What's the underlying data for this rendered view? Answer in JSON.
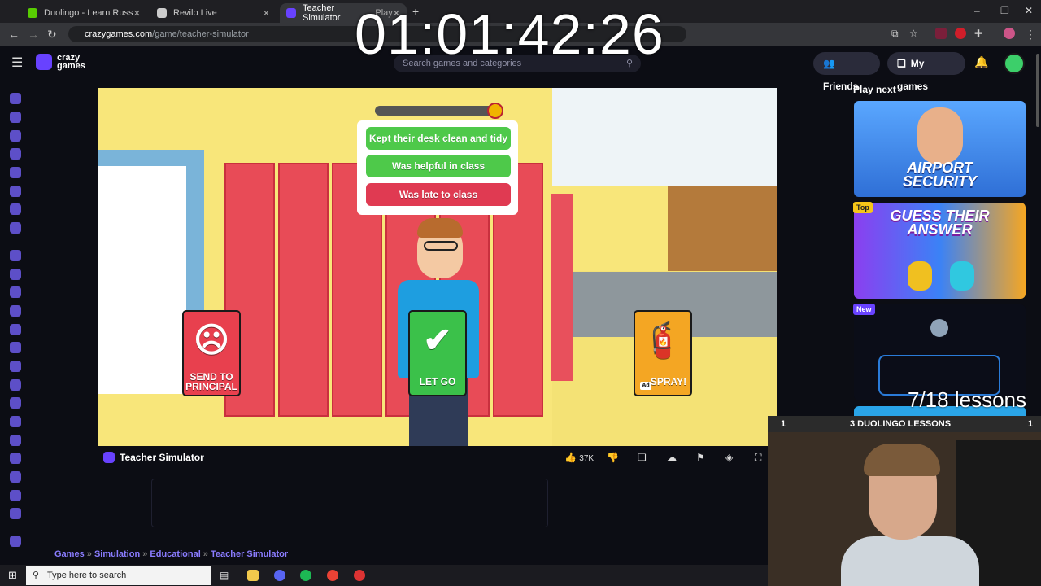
{
  "browser": {
    "tabs": [
      {
        "title": "Duolingo - Learn Russian with l",
        "active": false
      },
      {
        "title": "Revilo Live",
        "active": false
      },
      {
        "title": "Teacher Simulator",
        "active": true
      }
    ],
    "active_tab_suffix": "Play",
    "url_host": "crazygames.com",
    "url_path": "/game/teacher-simulator"
  },
  "site": {
    "logo_line1": "crazy",
    "logo_line2": "games",
    "search_placeholder": "Search games and categories",
    "friends_label": "Friends",
    "mygames_label": "My games"
  },
  "game": {
    "choices": [
      {
        "label": "Kept their desk clean and tidy",
        "color": "#4ec94a"
      },
      {
        "label": "Was helpful in class",
        "color": "#4ec94a"
      },
      {
        "label": "Was late to class",
        "color": "#e03a52"
      }
    ],
    "send_to_principal_line1": "SEND TO",
    "send_to_principal_line2": "PRINCIPAL",
    "let_go_label": "LET GO",
    "spray_label": "SPRAY!",
    "ad_tag": "Ad",
    "title": "Teacher Simulator",
    "likes": "37K"
  },
  "breadcrumbs": [
    "Games",
    "Simulation",
    "Educational",
    "Teacher Simulator"
  ],
  "right_rail": {
    "heading": "Play next",
    "cards": [
      {
        "title_line1": "AIRPORT",
        "title_line2": "SECURITY",
        "badge": ""
      },
      {
        "title_line1": "GUESS THEIR",
        "title_line2": "ANSWER",
        "badge": "Top"
      },
      {
        "title_line1": "",
        "title_line2": "",
        "badge": "New"
      }
    ]
  },
  "overlay": {
    "timer": "01:01:42:26",
    "lessons": "7/18 lessons",
    "duolingo_bar_left": "1",
    "duolingo_bar_title": "3 DUOLINGO LESSONS",
    "duolingo_bar_right": "1"
  },
  "taskbar": {
    "search_placeholder": "Type here to search"
  },
  "colors": {
    "accent": "#6842ff",
    "green": "#4ec94a",
    "red": "#e03a52"
  }
}
